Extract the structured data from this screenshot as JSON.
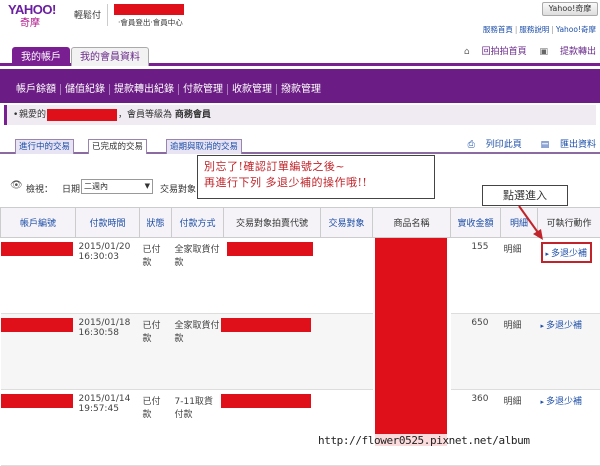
{
  "header": {
    "logo_text": "YAHOO!",
    "logo_sub": "奇摩",
    "service_name": "輕鬆付",
    "links": [
      "會員登出",
      "會員中心"
    ],
    "home_button": "Yahoo!奇摩",
    "top_links": [
      "服務首頁",
      "服務說明",
      "Yahoo!奇摩"
    ]
  },
  "account_tabs": [
    "我的帳戶",
    "我的會員資料"
  ],
  "header_actions": [
    "回拍拍首頁",
    "提款轉出"
  ],
  "menu": [
    "帳戶餘額",
    "儲值紀錄",
    "提款轉出紀錄",
    "付款管理",
    "收款管理",
    "撥款管理"
  ],
  "greeting": {
    "prefix": "親愛的",
    "middle": "，會員等級為",
    "level": "商務會員"
  },
  "tx_tabs": [
    "進行中的交易",
    "已完成的交易",
    "逾期與取消的交易"
  ],
  "tx_actions": [
    "列印此頁",
    "匯出資料"
  ],
  "filter": {
    "view_label": "檢視：",
    "date_label": "日期",
    "date_value": "二週內",
    "object_label": "交易對象"
  },
  "callout": {
    "line1": "別忘了!確認訂單編號之後~",
    "line2": "再進行下列 多退少補的操作哦!!"
  },
  "click_note": "點選進入",
  "table": {
    "headers": [
      "帳戶編號",
      "付款時間",
      "狀態",
      "付款方式",
      "交易對象拍賣代號",
      "交易對象",
      "商品名稱",
      "實收金額",
      "明細",
      "可執行動作"
    ],
    "rows": [
      {
        "date": "2015/01/20",
        "time": "16:30:03",
        "status": "已付款",
        "method": "全家取貨付款",
        "amount": "155",
        "detail": "明細",
        "action": "多退少補"
      },
      {
        "date": "2015/01/18",
        "time": "16:30:58",
        "status": "已付款",
        "method": "全家取貨付款",
        "amount": "650",
        "detail": "明細",
        "action": "多退少補"
      },
      {
        "date": "2015/01/14",
        "time": "19:57:45",
        "status": "已付款",
        "method": "7-11取貨付款",
        "amount": "360",
        "detail": "明細",
        "action": "多退少補"
      }
    ]
  },
  "watermark": "http://flower0525.pixnet.net/album",
  "colors": {
    "brand_purple": "#6c1d85",
    "redaction": "#e0101a",
    "link_blue": "#1d4fa8",
    "callout_red": "#c0242a"
  }
}
